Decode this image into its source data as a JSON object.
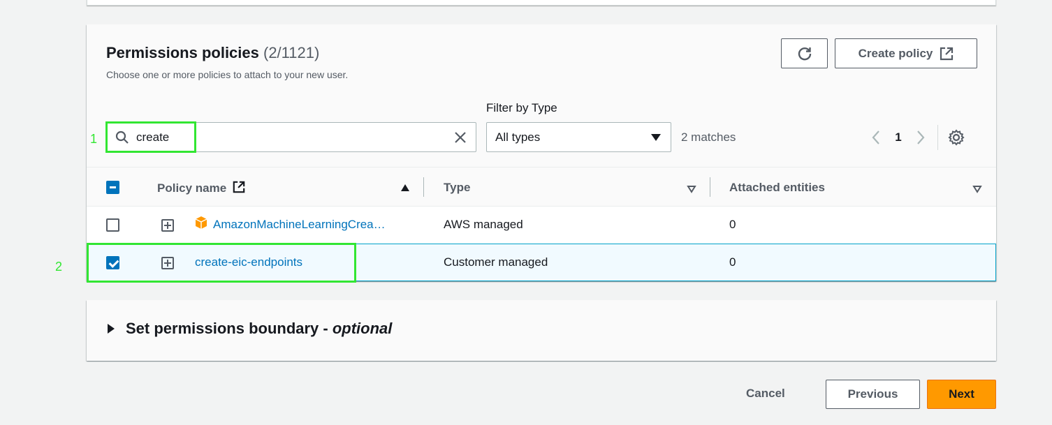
{
  "policies": {
    "title": "Permissions policies",
    "count": "(2/1121)",
    "subtitle": "Choose one or more policies to attach to your new user.",
    "create_label": "Create policy",
    "search": {
      "value": "create"
    },
    "filter_label": "Filter by Type",
    "filter_value": "All types",
    "matches": "2 matches",
    "page": "1",
    "columns": [
      "Policy name",
      "Type",
      "Attached entities"
    ],
    "rows": [
      {
        "name": "AmazonMachineLearningCrea…",
        "type": "AWS managed",
        "entities": "0",
        "checked": false
      },
      {
        "name": "create-eic-endpoints",
        "type": "Customer managed",
        "entities": "0",
        "checked": true
      }
    ]
  },
  "annotations": [
    "1",
    "2"
  ],
  "boundary": {
    "label": "Set permissions boundary - ",
    "optional": "optional"
  },
  "footer": {
    "cancel": "Cancel",
    "previous": "Previous",
    "next": "Next"
  },
  "colors": {
    "accent": "#0073bb",
    "primary": "#ff9900",
    "highlight": "#32e632"
  },
  "icons": [
    "refresh-icon",
    "external-link-icon",
    "search-icon",
    "clear-icon",
    "caret-down-icon",
    "chevron-left-icon",
    "chevron-right-icon",
    "gear-icon",
    "sort-asc-icon",
    "sort-desc-icon",
    "expand-icon",
    "aws-cube-icon",
    "expand-triangle-icon"
  ]
}
